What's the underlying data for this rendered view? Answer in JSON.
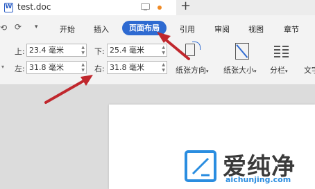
{
  "document": {
    "title": "test.doc"
  },
  "menu_tabs": {
    "kaishi": "开始",
    "charu": "插入",
    "page_layout": "页面布局",
    "yinyong": "引用",
    "shenyue": "审阅",
    "shitu": "视图",
    "zhangjie": "章节"
  },
  "margins": {
    "top_label": "上:",
    "top_value": "23.4 毫米",
    "bottom_label": "下:",
    "bottom_value": "25.4 毫米",
    "left_label": "左:",
    "left_value": "31.8 毫米",
    "right_label": "右:",
    "right_value": "31.8 毫米"
  },
  "ribbon": {
    "orientation_label": "纸张方向",
    "paper_size_label": "纸张大小",
    "columns_label": "分栏",
    "text_label": "文字"
  },
  "watermark": {
    "brand": "爱纯净",
    "url": "aichunjing.com"
  },
  "colors": {
    "accent": "#2e6ad1",
    "arrow": "#c0272d",
    "unsaved_dot": "#f08a24"
  }
}
